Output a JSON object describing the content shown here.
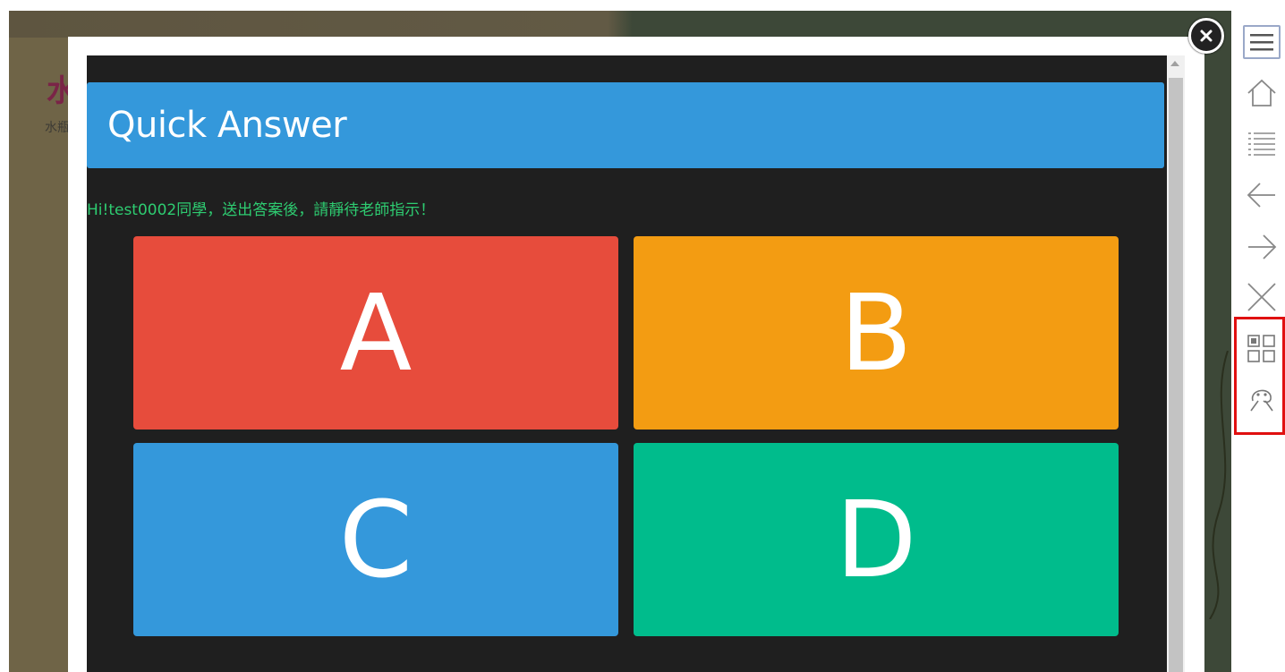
{
  "background": {
    "title_fragment": "水",
    "subtitle_fragment": "水瓶"
  },
  "modal": {
    "title": "Quick Answer",
    "greeting": "Hi!test0002同學，送出答案後，請靜待老師指示！",
    "answers": [
      {
        "label": "A",
        "color": "#e74c3c"
      },
      {
        "label": "B",
        "color": "#f39c12"
      },
      {
        "label": "C",
        "color": "#3498db"
      },
      {
        "label": "D",
        "color": "#00bc8c"
      }
    ]
  },
  "toolbar": {
    "items": [
      "menu-icon",
      "home-icon",
      "list-icon",
      "arrow-left-icon",
      "arrow-right-icon",
      "close-x-icon",
      "qr-grid-icon",
      "person-icon"
    ]
  },
  "colors": {
    "header": "#3498db",
    "greeting": "#2ecc71",
    "modal_body": "#1f1f1f",
    "highlight": "#e01010"
  }
}
